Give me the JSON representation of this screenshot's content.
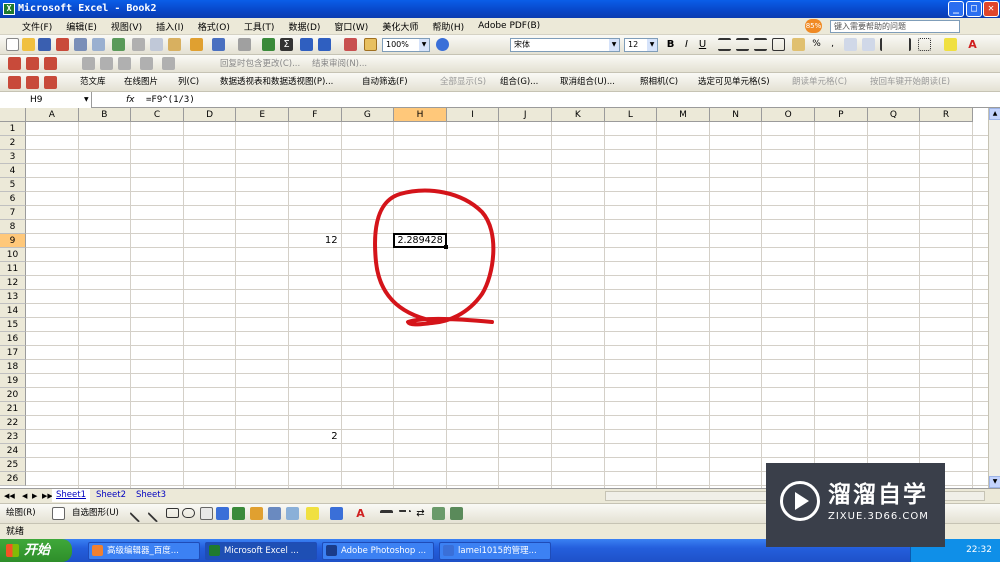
{
  "window": {
    "title": "Microsoft Excel - Book2",
    "app_icon": "X",
    "minimize": "_",
    "maximize": "□",
    "close": "✕"
  },
  "menu": {
    "items": [
      "文件(F)",
      "编辑(E)",
      "视图(V)",
      "插入(I)",
      "格式(O)",
      "工具(T)",
      "数据(D)",
      "窗口(W)",
      "美化大师",
      "帮助(H)",
      "Adobe PDF(B)"
    ],
    "help_badge": "85%",
    "help_placeholder": "键入需要帮助的问题"
  },
  "toolbar1": {
    "zoom": "100%",
    "font": "宋体",
    "font_size": "12"
  },
  "toolbar2": {
    "items": [
      "回复时包含更改(C)...",
      "结束审阅(N)..."
    ]
  },
  "toolbar3": {
    "items": [
      "范文库",
      "在线图片",
      "列(C)",
      "数据透视表和数据透视图(P)...",
      "自动筛选(F)",
      "全部显示(S)",
      "组合(G)...",
      "取消组合(U)...",
      "照相机(C)",
      "选定可见单元格(S)",
      "朗读单元格(C)",
      "按回车键开始朗读(E)"
    ]
  },
  "formula_bar": {
    "name_box": "H9",
    "fx": "fx",
    "formula": "=F9^(1/3)"
  },
  "columns": [
    "A",
    "B",
    "C",
    "D",
    "E",
    "F",
    "G",
    "H",
    "I",
    "J",
    "K",
    "L",
    "M",
    "N",
    "O",
    "P",
    "Q",
    "R"
  ],
  "selected_column": "H",
  "rows": [
    1,
    2,
    3,
    4,
    5,
    6,
    7,
    8,
    9,
    10,
    11,
    12,
    13,
    14,
    15,
    16,
    17,
    18,
    19,
    20,
    21,
    22,
    23,
    24,
    25,
    26
  ],
  "selected_row": 9,
  "cells": {
    "F9": "12",
    "H9": "2.289428",
    "F23": "2"
  },
  "sheets": {
    "tabs": [
      "Sheet1",
      "Sheet2",
      "Sheet3"
    ],
    "active": "Sheet1"
  },
  "drawing_toolbar": {
    "draw_label": "绘图(R)",
    "autoshapes_label": "自选图形(U)"
  },
  "status": {
    "text": "就绪"
  },
  "taskbar": {
    "start": "开始",
    "items": [
      "高级编辑器_百度...",
      "Microsoft Excel ...",
      "Adobe Photoshop ...",
      "lamei1015的管理..."
    ],
    "clock": "22:32"
  },
  "watermark": {
    "cn": "溜溜自学",
    "en": "ZIXUE.3D66.COM"
  },
  "colors": {
    "accent_title": "#0a5ee8",
    "highlight_header": "#ffc87a",
    "annotation": "#d4141a"
  }
}
